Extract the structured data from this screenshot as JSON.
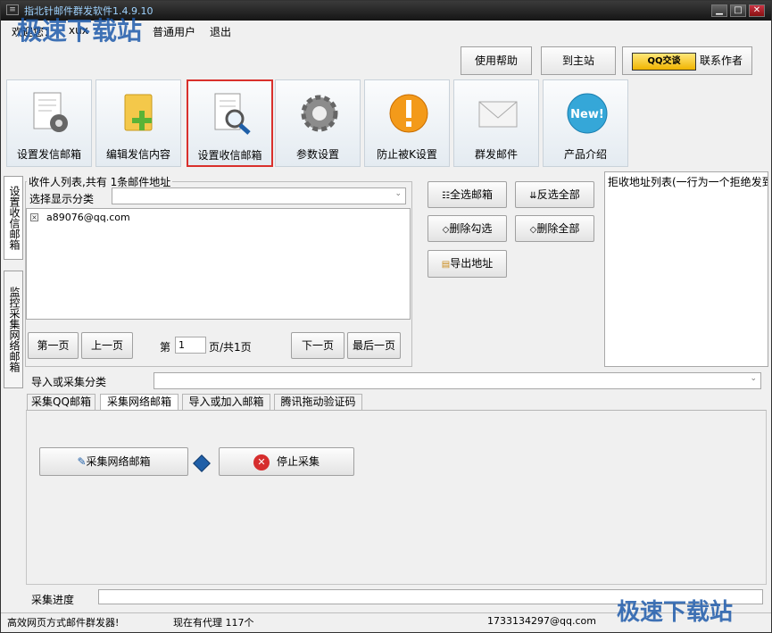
{
  "window": {
    "title": "指北针邮件群发软件1.4.9.10",
    "sys_glyph": "≡",
    "min_glyph": "▁",
    "max_glyph": "□",
    "close_glyph": "✕"
  },
  "menu": {
    "welcome": "欢迎您：",
    "user_partial": "xux",
    "user_suffix": "普通用户",
    "logout": "退出"
  },
  "header_buttons": {
    "help": "使用帮助",
    "home": "到主站",
    "qq_badge": "QQ交谈",
    "contact": "联系作者"
  },
  "toolbar": [
    {
      "label": "设置发信邮箱",
      "icon": "doc-gear-icon"
    },
    {
      "label": "编辑发信内容",
      "icon": "folder-plus-icon"
    },
    {
      "label": "设置收信邮箱",
      "icon": "doc-search-icon"
    },
    {
      "label": "参数设置",
      "icon": "gear-icon"
    },
    {
      "label": "防止被K设置",
      "icon": "warning-icon"
    },
    {
      "label": "群发邮件",
      "icon": "envelope-icon"
    },
    {
      "label": "产品介绍",
      "icon": "new-badge-icon",
      "badge_text": "New!"
    }
  ],
  "side_tabs": [
    "设置收信邮箱",
    "监控采集网络邮箱"
  ],
  "recipients": {
    "group_title": "收件人列表,共有 1条邮件地址",
    "category_label": "选择显示分类",
    "items": [
      {
        "email": "a89076@qq.com",
        "checked": true
      }
    ],
    "first_page": "第一页",
    "prev_page": "上一页",
    "page_prefix": "第",
    "page_value": "1",
    "page_suffix": "页/共1页",
    "next_page": "下一页",
    "last_page": "最后一页"
  },
  "actions": {
    "select_all": "全选邮箱",
    "invert": "反选全部",
    "delete_checked": "删除勾选",
    "delete_all": "删除全部",
    "export": "导出地址"
  },
  "reject_list": {
    "title": "拒收地址列表(一行为一个拒绝发到"
  },
  "import": {
    "label": "导入或采集分类"
  },
  "tabs": [
    "采集QQ邮箱",
    "采集网络邮箱",
    "导入或加入邮箱",
    "腾讯拖动验证码"
  ],
  "collect": {
    "start": "采集网络邮箱",
    "stop": "停止采集"
  },
  "progress": {
    "label": "采集进度",
    "value": 0
  },
  "statusbar": {
    "left": "高效网页方式邮件群发器!",
    "proxy": "现在有代理 117个",
    "email": "1733134297@qq.com"
  },
  "watermark": {
    "top": "极速下载站",
    "bottom": "极速下载站"
  }
}
